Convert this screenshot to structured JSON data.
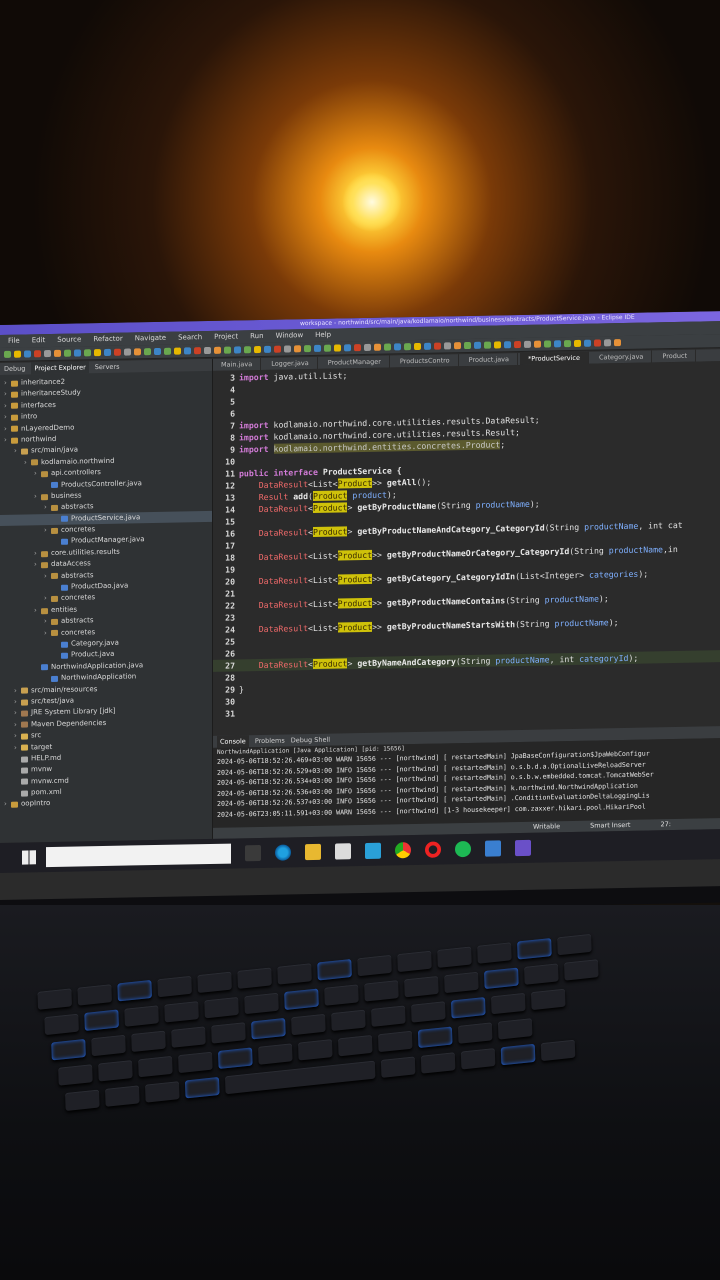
{
  "window_title": "workspace - northwind/src/main/java/kodlamaio/northwind/business/abstracts/ProductService.java - Eclipse IDE",
  "menu": [
    "File",
    "Edit",
    "Source",
    "Refactor",
    "Navigate",
    "Search",
    "Project",
    "Run",
    "Window",
    "Help"
  ],
  "explorer": {
    "tabs": [
      "Debug",
      "Project Explorer",
      "Servers"
    ],
    "items": [
      {
        "label": "inheritance2",
        "indent": 0,
        "type": "project"
      },
      {
        "label": "inheritanceStudy",
        "indent": 0,
        "type": "project"
      },
      {
        "label": "interfaces",
        "indent": 0,
        "type": "project"
      },
      {
        "label": "intro",
        "indent": 0,
        "type": "project"
      },
      {
        "label": "nLayeredDemo",
        "indent": 0,
        "type": "project"
      },
      {
        "label": "northwind",
        "indent": 0,
        "type": "project"
      },
      {
        "label": "src/main/java",
        "indent": 1,
        "type": "src"
      },
      {
        "label": "kodlamaio.northwind",
        "indent": 2,
        "type": "pkg"
      },
      {
        "label": "api.controllers",
        "indent": 3,
        "type": "pkg"
      },
      {
        "label": "ProductsController.java",
        "indent": 4,
        "type": "java"
      },
      {
        "label": "business",
        "indent": 3,
        "type": "pkg"
      },
      {
        "label": "abstracts",
        "indent": 4,
        "type": "pkg"
      },
      {
        "label": "ProductService.java",
        "indent": 5,
        "type": "java",
        "selected": true
      },
      {
        "label": "concretes",
        "indent": 4,
        "type": "pkg"
      },
      {
        "label": "ProductManager.java",
        "indent": 5,
        "type": "java"
      },
      {
        "label": "core.utilities.results",
        "indent": 3,
        "type": "pkg"
      },
      {
        "label": "dataAccess",
        "indent": 3,
        "type": "pkg"
      },
      {
        "label": "abstracts",
        "indent": 4,
        "type": "pkg"
      },
      {
        "label": "ProductDao.java",
        "indent": 5,
        "type": "java"
      },
      {
        "label": "concretes",
        "indent": 4,
        "type": "pkg"
      },
      {
        "label": "entities",
        "indent": 3,
        "type": "pkg"
      },
      {
        "label": "abstracts",
        "indent": 4,
        "type": "pkg"
      },
      {
        "label": "concretes",
        "indent": 4,
        "type": "pkg"
      },
      {
        "label": "Category.java",
        "indent": 5,
        "type": "java"
      },
      {
        "label": "Product.java",
        "indent": 5,
        "type": "java"
      },
      {
        "label": "NorthwindApplication.java",
        "indent": 3,
        "type": "java"
      },
      {
        "label": "NorthwindApplication",
        "indent": 4,
        "type": "java"
      },
      {
        "label": "src/main/resources",
        "indent": 1,
        "type": "src"
      },
      {
        "label": "src/test/java",
        "indent": 1,
        "type": "src"
      },
      {
        "label": "JRE System Library [jdk]",
        "indent": 1,
        "type": "lib"
      },
      {
        "label": "Maven Dependencies",
        "indent": 1,
        "type": "lib"
      },
      {
        "label": "src",
        "indent": 1,
        "type": "folder"
      },
      {
        "label": "target",
        "indent": 1,
        "type": "folder"
      },
      {
        "label": "HELP.md",
        "indent": 1,
        "type": "file"
      },
      {
        "label": "mvnw",
        "indent": 1,
        "type": "file"
      },
      {
        "label": "mvnw.cmd",
        "indent": 1,
        "type": "file"
      },
      {
        "label": "pom.xml",
        "indent": 1,
        "type": "file"
      },
      {
        "label": "oopIntro",
        "indent": 0,
        "type": "project"
      }
    ]
  },
  "editor_tabs": [
    {
      "label": "Main.java"
    },
    {
      "label": "Logger.java"
    },
    {
      "label": "ProductManager"
    },
    {
      "label": "ProductsContro"
    },
    {
      "label": "Product.java"
    },
    {
      "label": "*ProductService",
      "active": true
    },
    {
      "label": "Category.java"
    },
    {
      "label": "Product"
    }
  ],
  "code": [
    {
      "n": "3",
      "segs": [
        [
          "kw",
          "import "
        ],
        [
          "imp",
          "java.util.List;"
        ]
      ]
    },
    {
      "n": "4",
      "segs": []
    },
    {
      "n": "5",
      "segs": []
    },
    {
      "n": "6",
      "segs": []
    },
    {
      "n": "7",
      "segs": [
        [
          "kw",
          "import "
        ],
        [
          "imp",
          "kodlamaio.northwind.core.utilities.results.DataResult;"
        ]
      ]
    },
    {
      "n": "8",
      "segs": [
        [
          "kw",
          "import "
        ],
        [
          "imp",
          "kodlamaio.northwind.core.utilities.results.Result;"
        ]
      ]
    },
    {
      "n": "9",
      "segs": [
        [
          "kw",
          "import "
        ],
        [
          "hl",
          "kodlamaio.northwind.entities.concretes.Product"
        ],
        [
          "imp",
          ";"
        ]
      ]
    },
    {
      "n": "10",
      "segs": []
    },
    {
      "n": "11",
      "segs": [
        [
          "kw",
          "public interface "
        ],
        [
          "meth",
          "ProductService {"
        ]
      ]
    },
    {
      "n": "12",
      "segs": [
        [
          "imp",
          "    "
        ],
        [
          "ty",
          "DataResult"
        ],
        [
          "imp",
          "<List<"
        ],
        [
          "gen",
          "Product"
        ],
        [
          "imp",
          ">> "
        ],
        [
          "meth",
          "getAll"
        ],
        [
          "imp",
          "();"
        ]
      ]
    },
    {
      "n": "13",
      "segs": [
        [
          "imp",
          "    "
        ],
        [
          "ty",
          "Result "
        ],
        [
          "meth",
          "add"
        ],
        [
          "imp",
          "("
        ],
        [
          "gen",
          "Product"
        ],
        [
          "prm",
          " product"
        ],
        [
          "imp",
          ");"
        ]
      ]
    },
    {
      "n": "14",
      "segs": [
        [
          "imp",
          "    "
        ],
        [
          "ty",
          "DataResult"
        ],
        [
          "imp",
          "<"
        ],
        [
          "gen",
          "Product"
        ],
        [
          "imp",
          "> "
        ],
        [
          "meth",
          "getByProductName"
        ],
        [
          "imp",
          "(String "
        ],
        [
          "prm",
          "productName"
        ],
        [
          "imp",
          ");"
        ]
      ]
    },
    {
      "n": "15",
      "segs": []
    },
    {
      "n": "16",
      "segs": [
        [
          "imp",
          "    "
        ],
        [
          "ty",
          "DataResult"
        ],
        [
          "imp",
          "<"
        ],
        [
          "gen",
          "Product"
        ],
        [
          "imp",
          "> "
        ],
        [
          "meth",
          "getByProductNameAndCategory_CategoryId"
        ],
        [
          "imp",
          "(String "
        ],
        [
          "prm",
          "productName"
        ],
        [
          "imp",
          ", int cat"
        ]
      ]
    },
    {
      "n": "17",
      "segs": []
    },
    {
      "n": "18",
      "segs": [
        [
          "imp",
          "    "
        ],
        [
          "ty",
          "DataResult"
        ],
        [
          "imp",
          "<List<"
        ],
        [
          "gen",
          "Product"
        ],
        [
          "imp",
          ">> "
        ],
        [
          "meth",
          "getByProductNameOrCategory_CategoryId"
        ],
        [
          "imp",
          "(String "
        ],
        [
          "prm",
          "productName"
        ],
        [
          "imp",
          ",in"
        ]
      ]
    },
    {
      "n": "19",
      "segs": []
    },
    {
      "n": "20",
      "segs": [
        [
          "imp",
          "    "
        ],
        [
          "ty",
          "DataResult"
        ],
        [
          "imp",
          "<List<"
        ],
        [
          "gen",
          "Product"
        ],
        [
          "imp",
          ">> "
        ],
        [
          "meth",
          "getByCategory_CategoryIdIn"
        ],
        [
          "imp",
          "(List<Integer> "
        ],
        [
          "prm",
          "categories"
        ],
        [
          "imp",
          ");"
        ]
      ]
    },
    {
      "n": "21",
      "segs": []
    },
    {
      "n": "22",
      "segs": [
        [
          "imp",
          "    "
        ],
        [
          "ty",
          "DataResult"
        ],
        [
          "imp",
          "<List<"
        ],
        [
          "gen",
          "Product"
        ],
        [
          "imp",
          ">> "
        ],
        [
          "meth",
          "getByProductNameContains"
        ],
        [
          "imp",
          "(String "
        ],
        [
          "prm",
          "productName"
        ],
        [
          "imp",
          ");"
        ]
      ]
    },
    {
      "n": "23",
      "segs": []
    },
    {
      "n": "24",
      "segs": [
        [
          "imp",
          "    "
        ],
        [
          "ty",
          "DataResult"
        ],
        [
          "imp",
          "<List<"
        ],
        [
          "gen",
          "Product"
        ],
        [
          "imp",
          ">> "
        ],
        [
          "meth",
          "getByProductNameStartsWith"
        ],
        [
          "imp",
          "(String "
        ],
        [
          "prm",
          "productName"
        ],
        [
          "imp",
          ");"
        ]
      ]
    },
    {
      "n": "25",
      "segs": []
    },
    {
      "n": "26",
      "segs": []
    },
    {
      "n": "27",
      "segs": [
        [
          "imp",
          "    "
        ],
        [
          "ty",
          "DataResult"
        ],
        [
          "imp",
          "<"
        ],
        [
          "gen",
          "Product"
        ],
        [
          "imp",
          "> "
        ],
        [
          "meth",
          "getByNameAndCategory"
        ],
        [
          "imp",
          "(String "
        ],
        [
          "prm",
          "productName"
        ],
        [
          "imp",
          ", int "
        ],
        [
          "prm",
          "categoryId"
        ],
        [
          "imp",
          ");"
        ]
      ],
      "current": true
    },
    {
      "n": "28",
      "segs": []
    },
    {
      "n": "29",
      "segs": [
        [
          "imp",
          "}"
        ]
      ]
    },
    {
      "n": "30",
      "segs": []
    },
    {
      "n": "31",
      "segs": []
    }
  ],
  "console": {
    "tabs": [
      "Console",
      "Problems",
      "Debug Shell"
    ],
    "header": "NorthwindApplication [Java Application] [pid: 15656]",
    "lines": [
      "2024-05-06T18:52:26.469+03:00  WARN 15656 --- [northwind] [  restartedMain] JpaBaseConfiguration$JpaWebConfigur",
      "2024-05-06T18:52:26.529+03:00  INFO 15656 --- [northwind] [  restartedMain] o.s.b.d.a.OptionalLiveReloadServer",
      "2024-05-06T18:52:26.534+03:00  INFO 15656 --- [northwind] [  restartedMain] o.s.b.w.embedded.tomcat.TomcatWebSer",
      "2024-05-06T18:52:26.536+03:00  INFO 15656 --- [northwind] [  restartedMain] k.northwind.NorthwindApplication",
      "2024-05-06T18:52:26.537+03:00  INFO 15656 --- [northwind] [  restartedMain] .ConditionEvaluationDeltaLoggingLis",
      "2024-05-06T23:05:11.591+03:00  WARN 15656 --- [northwind] [1-3 housekeeper] com.zaxxer.hikari.pool.HikariPool"
    ]
  },
  "status": {
    "writable": "Writable",
    "insert": "Smart Insert",
    "position": "27:"
  },
  "taskbar": {
    "search_placeholder": ""
  },
  "colors": {
    "title_bar": "#6a5ad6",
    "ide_bg": "#2b2b2b",
    "keyword": "#d27bd7",
    "type": "#ef6a6a",
    "generic_highlight": "#cfc20a"
  }
}
